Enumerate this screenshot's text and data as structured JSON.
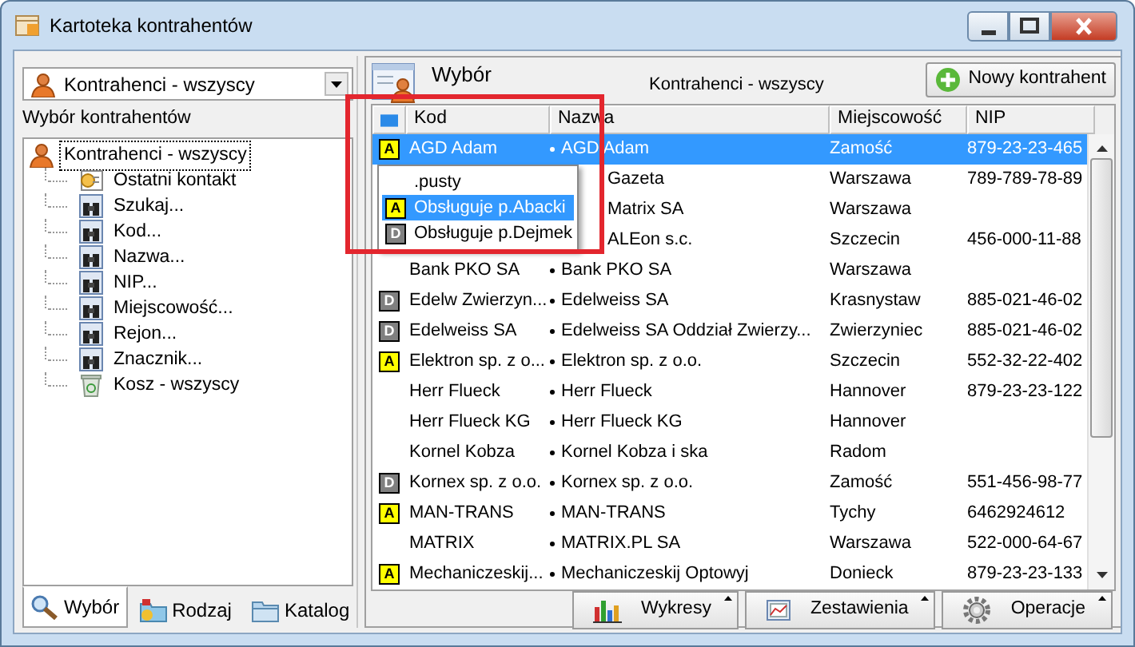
{
  "window": {
    "title": "Kartoteka kontrahentów"
  },
  "left_panel": {
    "filter_combo": {
      "value": "Kontrahenci - wszyscy"
    },
    "label": "Wybór kontrahentów",
    "tree": [
      {
        "label": "Kontrahenci - wszyscy",
        "kind": "person",
        "selected": true,
        "children": [
          {
            "label": "Ostatni kontakt",
            "kind": "recent",
            "selected": false
          },
          {
            "label": "Szukaj...",
            "kind": "search",
            "selected": false
          },
          {
            "label": "Kod...",
            "kind": "search",
            "selected": false
          },
          {
            "label": "Nazwa...",
            "kind": "search",
            "selected": false
          },
          {
            "label": "NIP...",
            "kind": "search",
            "selected": false
          },
          {
            "label": "Miejscowość...",
            "kind": "search",
            "selected": false
          },
          {
            "label": "Rejon...",
            "kind": "search",
            "selected": false
          },
          {
            "label": "Znacznik...",
            "kind": "search",
            "selected": false
          },
          {
            "label": "Kosz - wszyscy",
            "kind": "trash",
            "selected": false
          }
        ]
      }
    ],
    "tabs": [
      {
        "label": "Wybór",
        "kind": "search",
        "selected": true
      },
      {
        "label": "Rodzaj",
        "kind": "kind",
        "selected": false
      },
      {
        "label": "Katalog",
        "kind": "folder",
        "selected": false
      }
    ]
  },
  "right_panel": {
    "title": "Wybór",
    "subtitle": "Kontrahenci - wszyscy",
    "new_button": "Nowy kontrahent",
    "table": {
      "columns": [
        "Kod",
        "Nazwa",
        "Miejscowość",
        "NIP"
      ],
      "rows": [
        {
          "tag": {
            "label": "A",
            "color": "#ffff00"
          },
          "code": "AGD Adam",
          "name": "AGD Adam",
          "city": "Zamość",
          "nip": "879-23-23-465",
          "selected": true
        },
        {
          "covered": true,
          "name": "Gazeta",
          "city": "Warszawa",
          "nip": "789-789-78-89",
          "selected": false
        },
        {
          "covered": true,
          "name": "Matrix SA",
          "city": "Warszawa",
          "nip": "",
          "selected": false
        },
        {
          "covered": true,
          "name": "ALEon s.c.",
          "city": "Szczecin",
          "nip": "456-000-11-88",
          "selected": false
        },
        {
          "code": "Bank PKO SA",
          "name": "Bank PKO SA",
          "city": "Warszawa",
          "nip": "",
          "selected": false
        },
        {
          "tag": {
            "label": "D",
            "color": "#808080"
          },
          "code": "Edelw Zwierzyn...",
          "name": "Edelweiss SA",
          "city": "Krasnystaw",
          "nip": "885-021-46-02",
          "selected": false
        },
        {
          "tag": {
            "label": "D",
            "color": "#808080"
          },
          "code": "Edelweiss SA",
          "name": "Edelweiss SA Oddział Zwierzy...",
          "city": "Zwierzyniec",
          "nip": "885-021-46-02",
          "selected": false
        },
        {
          "tag": {
            "label": "A",
            "color": "#ffff00"
          },
          "code": "Elektron sp. z o...",
          "name": "Elektron sp. z o.o.",
          "city": "Szczecin",
          "nip": "552-32-22-402",
          "selected": false
        },
        {
          "code": "Herr Flueck",
          "name": "Herr Flueck",
          "city": "Hannover",
          "nip": "879-23-23-122",
          "selected": false
        },
        {
          "code": "Herr Flueck KG",
          "name": "Herr Flueck KG",
          "city": "Hannover",
          "nip": "",
          "selected": false
        },
        {
          "code": "Kornel Kobza",
          "name": "Kornel Kobza i ska",
          "city": "Radom",
          "nip": "",
          "selected": false
        },
        {
          "tag": {
            "label": "D",
            "color": "#808080"
          },
          "code": "Kornex sp. z o.o.",
          "name": "Kornex sp. z o.o.",
          "city": "Zamość",
          "nip": "551-456-98-77",
          "selected": false
        },
        {
          "tag": {
            "label": "A",
            "color": "#ffff00"
          },
          "code": "MAN-TRANS",
          "name": "MAN-TRANS",
          "city": "Tychy",
          "nip": "6462924612",
          "selected": false
        },
        {
          "code": "MATRIX",
          "name": "MATRIX.PL SA",
          "city": "Warszawa",
          "nip": "522-000-64-67",
          "selected": false
        },
        {
          "tag": {
            "label": "A",
            "color": "#ffff00"
          },
          "code": "Mechaniczeskij...",
          "name": "Mechaniczeskij Optowyj",
          "city": "Donieck",
          "nip": "879-23-23-133",
          "selected": false
        }
      ]
    },
    "tag_menu": [
      {
        "label": ".pusty",
        "selected": false
      },
      {
        "tag": {
          "label": "A",
          "color": "#ffff00"
        },
        "label": "Obsługuje p.Abacki",
        "selected": true
      },
      {
        "tag": {
          "label": "D",
          "color": "#808080"
        },
        "label": "Obsługuje p.Dejmek",
        "selected": false
      }
    ],
    "toolbar": [
      {
        "label": "Wykresy",
        "kind": "chart"
      },
      {
        "label": "Zestawienia",
        "kind": "report"
      },
      {
        "label": "Operacje",
        "kind": "gear"
      }
    ]
  }
}
